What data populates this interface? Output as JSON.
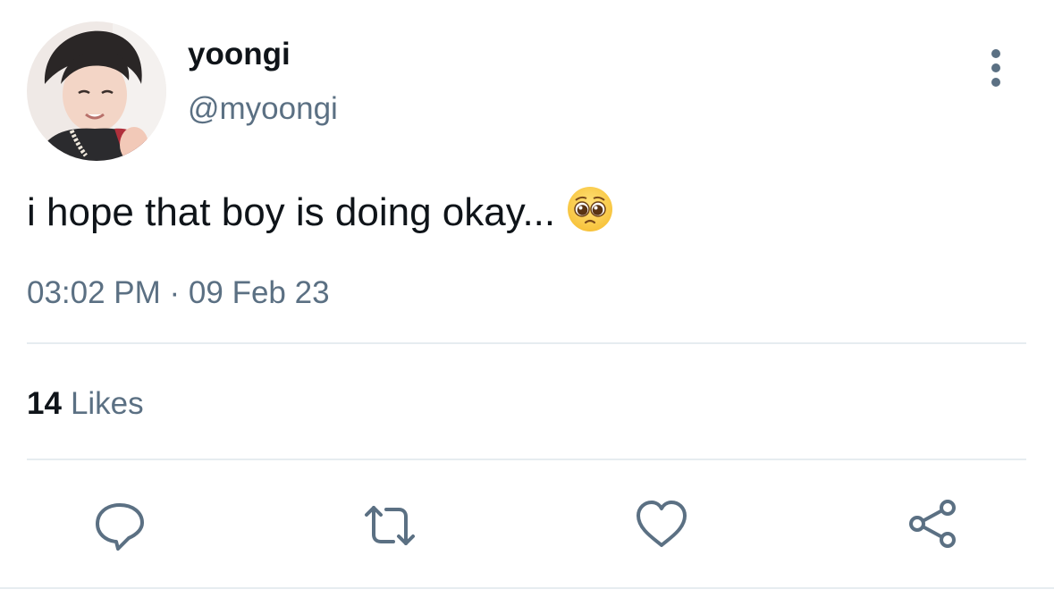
{
  "tweet": {
    "display_name": "yoongi",
    "handle": "@myoongi",
    "text": "i hope that boy is doing okay...",
    "emoji": "pleading-face",
    "timestamp": "03:02 PM · 09 Feb 23",
    "likes_count": "14",
    "likes_label": "Likes"
  },
  "icons": {
    "more": "more-vertical-icon",
    "reply": "reply-icon",
    "retweet": "retweet-icon",
    "like": "heart-icon",
    "share": "share-icon"
  },
  "colors": {
    "text_primary": "#0f1419",
    "text_secondary": "#5b7083",
    "divider": "#e6ecf0",
    "icon": "#5b7083"
  }
}
